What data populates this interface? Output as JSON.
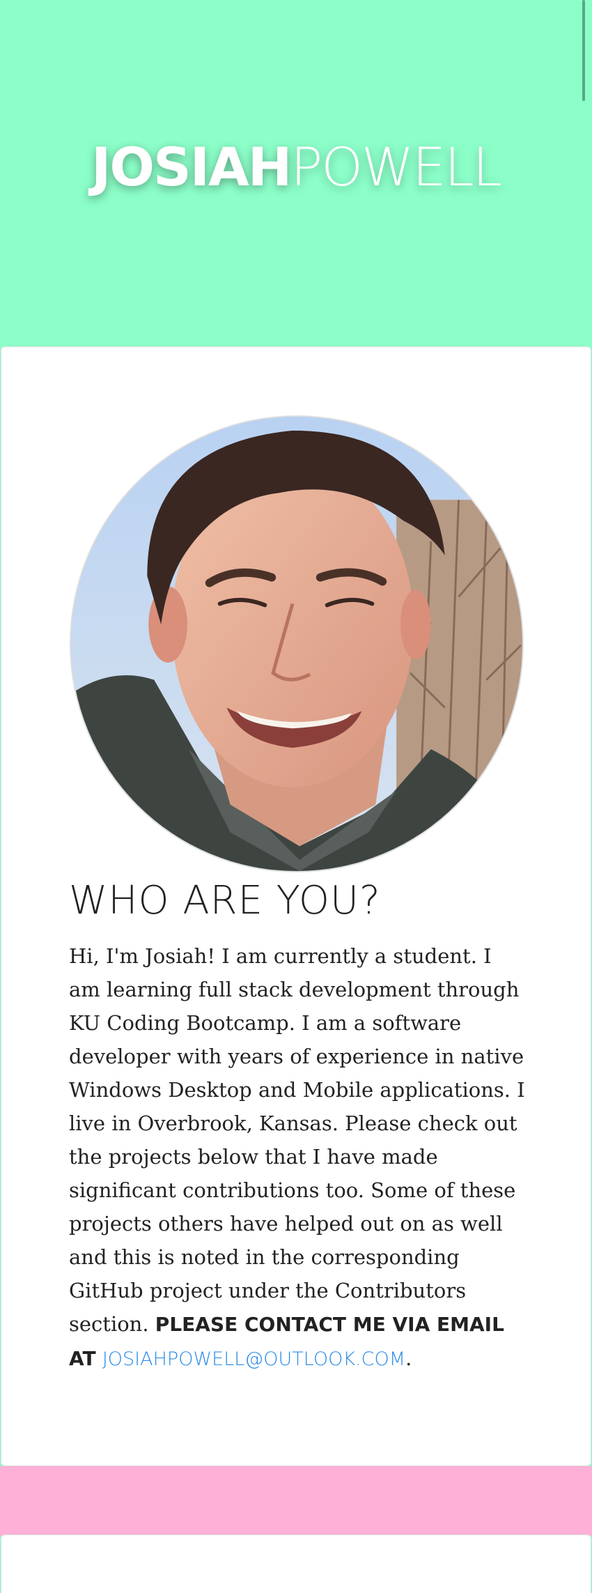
{
  "header": {
    "first_name": "JOSIAH",
    "last_name": "POWELL"
  },
  "about": {
    "photo_alt": "Josiah Powell",
    "heading": "WHO ARE YOU?",
    "bio_text": "Hi, I'm Josiah! I am currently a student. I am learning full stack development through KU Coding Bootcamp. I am a software developer with years of experience in native Windows Desktop and Mobile applications. I live in Overbrook, Kansas. Please check out the projects below that I have made significant contributions too. Some of these projects others have helped out on as well and this is noted in the corresponding GitHub project under the Contributors section.",
    "cta_text": "PLEASE CONTACT ME VIA EMAIL AT",
    "email": "JOSIAHPOWELL@OUTLOOK.COM",
    "email_period": "."
  },
  "colors": {
    "hero_background": "#8cffc9",
    "accent_band": "#ffb0d6",
    "link": "#2a8be8"
  }
}
